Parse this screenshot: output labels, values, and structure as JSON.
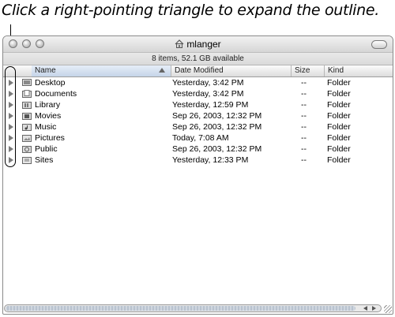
{
  "caption": "Click a right-pointing triangle to expand the outline.",
  "window": {
    "title": "mlanger",
    "status": "8 items, 52.1 GB available"
  },
  "columns": {
    "name": "Name",
    "date": "Date Modified",
    "size": "Size",
    "kind": "Kind"
  },
  "rows": [
    {
      "name": "Desktop",
      "date": "Yesterday, 3:42 PM",
      "size": "--",
      "kind": "Folder",
      "icon": "desktop-folder-icon"
    },
    {
      "name": "Documents",
      "date": "Yesterday, 3:42 PM",
      "size": "--",
      "kind": "Folder",
      "icon": "documents-folder-icon"
    },
    {
      "name": "Library",
      "date": "Yesterday, 12:59 PM",
      "size": "--",
      "kind": "Folder",
      "icon": "library-folder-icon"
    },
    {
      "name": "Movies",
      "date": "Sep 26, 2003, 12:32 PM",
      "size": "--",
      "kind": "Folder",
      "icon": "movies-folder-icon"
    },
    {
      "name": "Music",
      "date": "Sep 26, 2003, 12:32 PM",
      "size": "--",
      "kind": "Folder",
      "icon": "music-folder-icon"
    },
    {
      "name": "Pictures",
      "date": "Today, 7:08 AM",
      "size": "--",
      "kind": "Folder",
      "icon": "pictures-folder-icon"
    },
    {
      "name": "Public",
      "date": "Sep 26, 2003, 12:32 PM",
      "size": "--",
      "kind": "Folder",
      "icon": "public-folder-icon"
    },
    {
      "name": "Sites",
      "date": "Yesterday, 12:33 PM",
      "size": "--",
      "kind": "Folder",
      "icon": "sites-folder-icon"
    }
  ]
}
